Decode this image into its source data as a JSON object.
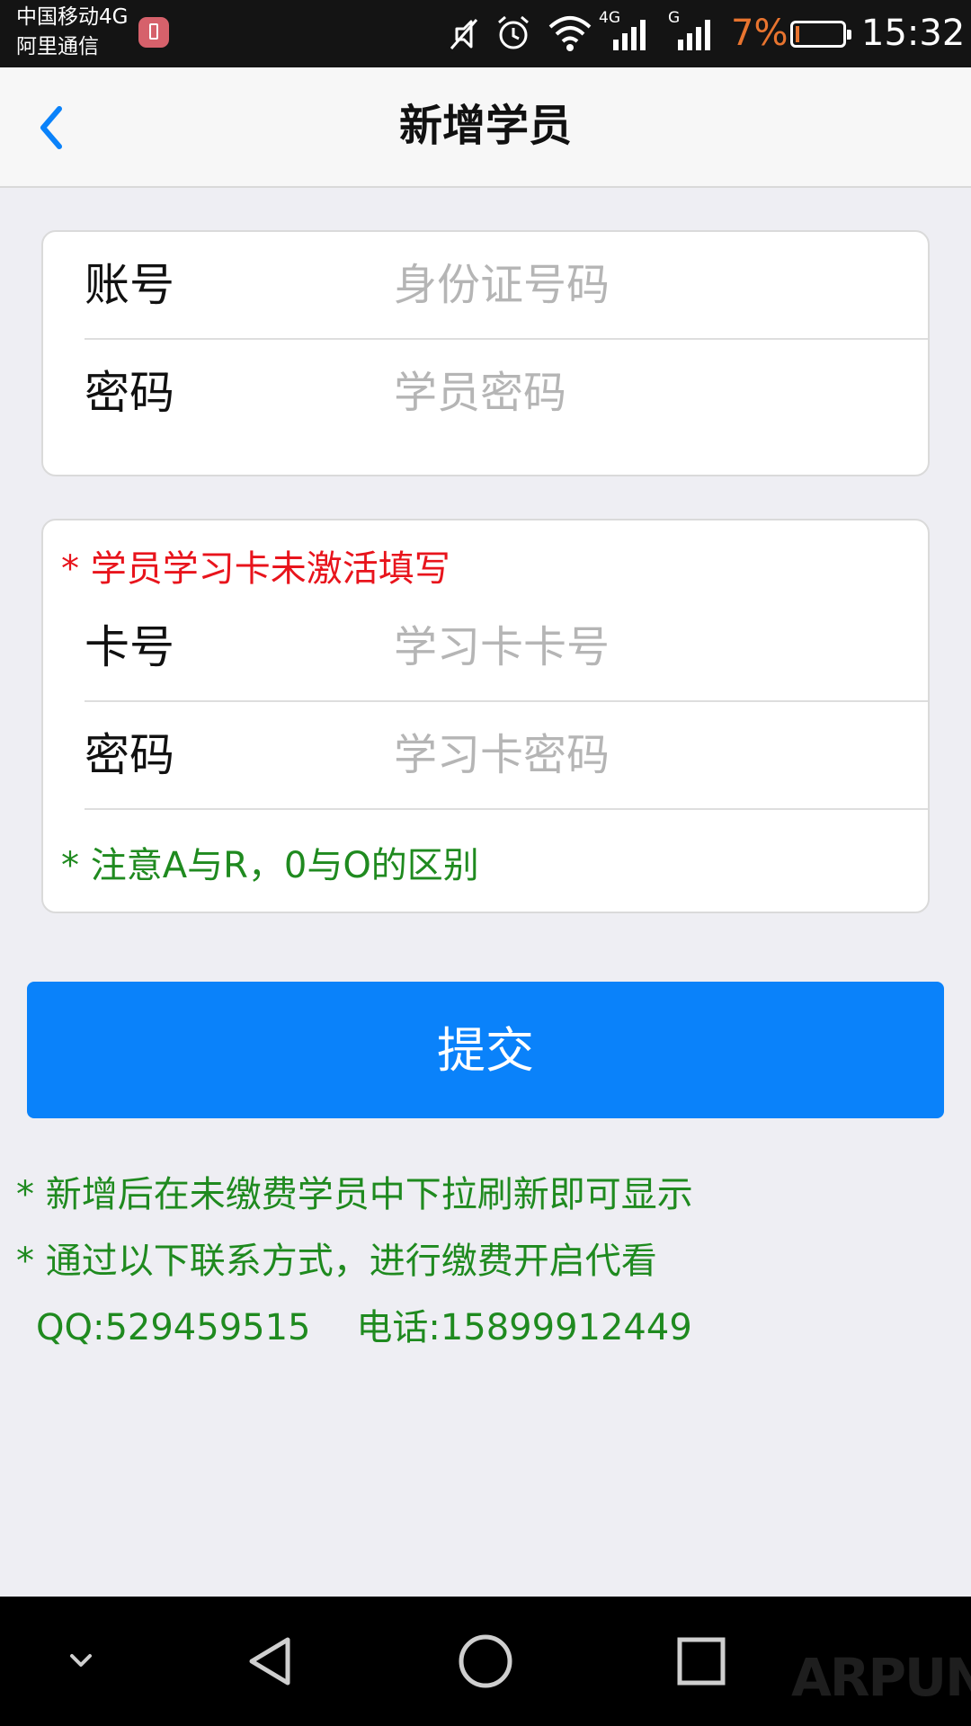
{
  "status_bar": {
    "carrier_line1": "中国移动4G",
    "carrier_line2": "阿里通信",
    "battery_percent": "7%",
    "battery_level": 0.07,
    "time": "15:32",
    "network_label_1": "4G",
    "network_label_2": "G",
    "icons": [
      "notification-icon",
      "mute-icon",
      "alarm-icon",
      "wifi-icon",
      "signal-icon",
      "signal-icon",
      "battery-icon"
    ],
    "colors": {
      "battery_text": "#e8742f",
      "background": "#141414"
    }
  },
  "nav": {
    "title": "新增学员",
    "back_icon": "chevron-left-icon",
    "accent": "#0a82fa"
  },
  "account_card": {
    "account_label": "账号",
    "account_placeholder": "身份证号码",
    "password_label": "密码",
    "password_placeholder": "学员密码"
  },
  "study_card": {
    "hint": "* 学员学习卡未激活填写",
    "card_no_label": "卡号",
    "card_no_placeholder": "学习卡卡号",
    "card_pwd_label": "密码",
    "card_pwd_placeholder": "学习卡密码",
    "note": "* 注意A与R，0与O的区别"
  },
  "submit_label": "提交",
  "notes": {
    "line1": "* 新增后在未缴费学员中下拉刷新即可显示",
    "line2": "* 通过以下联系方式，进行缴费开启代看",
    "line3": "QQ:529459515    电话:15899912449"
  },
  "watermark": "ARPUN",
  "android_nav": [
    "chevron-down-icon",
    "back-triangle-icon",
    "home-circle-icon",
    "recents-square-icon"
  ]
}
